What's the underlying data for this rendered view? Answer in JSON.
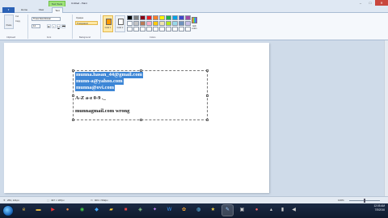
{
  "titlebar": {
    "context_tab": "Text Tools",
    "doc_title": "Untitled - Paint",
    "minimize": "–",
    "maximize": "□",
    "close": "✕"
  },
  "tabs": {
    "file": "▾",
    "home": "Home",
    "view": "View",
    "text": "Text"
  },
  "ribbon": {
    "paste": "Paste",
    "cut": "Cut",
    "copy": "Copy",
    "clipboard_label": "Clipboard",
    "font_name": "Times New Roman",
    "font_size": "14",
    "font_label": "Font",
    "bold": "B",
    "italic": "I",
    "underline": "U",
    "strike": "abc",
    "opaque": "Opaque",
    "transparent": "Transparent",
    "background_label": "Background",
    "color1_label": "Color 1",
    "color2_label": "Color 2",
    "edit_colors": "Edit colors",
    "colors_label": "Colors"
  },
  "palette_colors": [
    "#000000",
    "#7f7f7f",
    "#880015",
    "#ed1c24",
    "#ff7f27",
    "#fff200",
    "#22b14c",
    "#00a2e8",
    "#3f48cc",
    "#a349a4",
    "#ffffff",
    "#c3c3c3",
    "#b97a57",
    "#ffaec9",
    "#ffc90e",
    "#efe4b0",
    "#b5e61d",
    "#99d9ea",
    "#7092be",
    "#c8bfe7",
    "#ffffff",
    "#ffffff",
    "#ffffff",
    "#ffffff",
    "#ffffff",
    "#ffffff",
    "#ffffff",
    "#ffffff",
    "#ffffff",
    "#ffffff"
  ],
  "color1": "#ff9900",
  "color2": "#ffffff",
  "canvas_text": {
    "line1": "munna.hasan_44@gmail.com",
    "line2": "munn-a@yahoo.com",
    "line3": "munna@ovi.com",
    "line4": "A-Z  a-z  0-9  ._",
    "line5": "munnagmail.com     wrong"
  },
  "status": {
    "cursor_pos": "253, 121px",
    "selection_size": "497 × 187px",
    "canvas_size": "903 × 562px",
    "zoom": "100%"
  },
  "taskbar": {
    "time": "12:05 AM",
    "date": "7/5/2016"
  }
}
